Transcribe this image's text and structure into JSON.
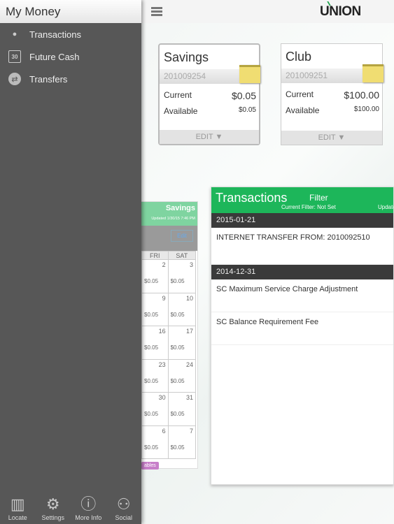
{
  "header": {
    "logo": "UNION",
    "menu_icon": "hamburger-icon"
  },
  "accounts": [
    {
      "name": "Savings",
      "number": "201009254",
      "current_label": "Current",
      "current": "$0.05",
      "available_label": "Available",
      "available": "$0.05",
      "edit": "EDIT ▼"
    },
    {
      "name": "Club",
      "number": "201009251",
      "current_label": "Current",
      "current": "$100.00",
      "available_label": "Available",
      "available": "$100.00",
      "edit": "EDIT ▼"
    }
  ],
  "calendar": {
    "account": "Savings",
    "updated": "Updated 1/30/15 7:46 PM",
    "edit": "Edit",
    "days": [
      "FRI",
      "SAT"
    ],
    "weeks": [
      [
        "2",
        "3"
      ],
      [
        "9",
        "10"
      ],
      [
        "16",
        "17"
      ],
      [
        "23",
        "24"
      ],
      [
        "30",
        "31"
      ],
      [
        "6",
        "7"
      ]
    ],
    "amount": "$0.05",
    "badge": "ables"
  },
  "transactions": {
    "title": "Transactions",
    "filter": "Filter",
    "current_filter": "Current Filter: Not Set",
    "updated": "Update",
    "groups": [
      {
        "date": "2015-01-21",
        "items": [
          "INTERNET TRANSFER FROM: 2010092510"
        ]
      },
      {
        "date": "2014-12-31",
        "items": [
          "SC Maximum Service Charge Adjustment",
          "SC Balance Requirement Fee"
        ]
      }
    ]
  },
  "sidebar": {
    "title": "My Money",
    "items": [
      {
        "label": "Transactions",
        "icon": "hand-coin-icon"
      },
      {
        "label": "Future Cash",
        "icon": "calendar-icon"
      },
      {
        "label": "Transfers",
        "icon": "transfer-icon"
      }
    ],
    "bottom": [
      {
        "label": "Locate",
        "icon": "map-pin-icon"
      },
      {
        "label": "Settings",
        "icon": "gear-icon"
      },
      {
        "label": "More Info",
        "icon": "info-icon"
      },
      {
        "label": "Social",
        "icon": "people-icon"
      }
    ]
  },
  "colors": {
    "green": "#1db65a",
    "sidebar": "#575757"
  }
}
